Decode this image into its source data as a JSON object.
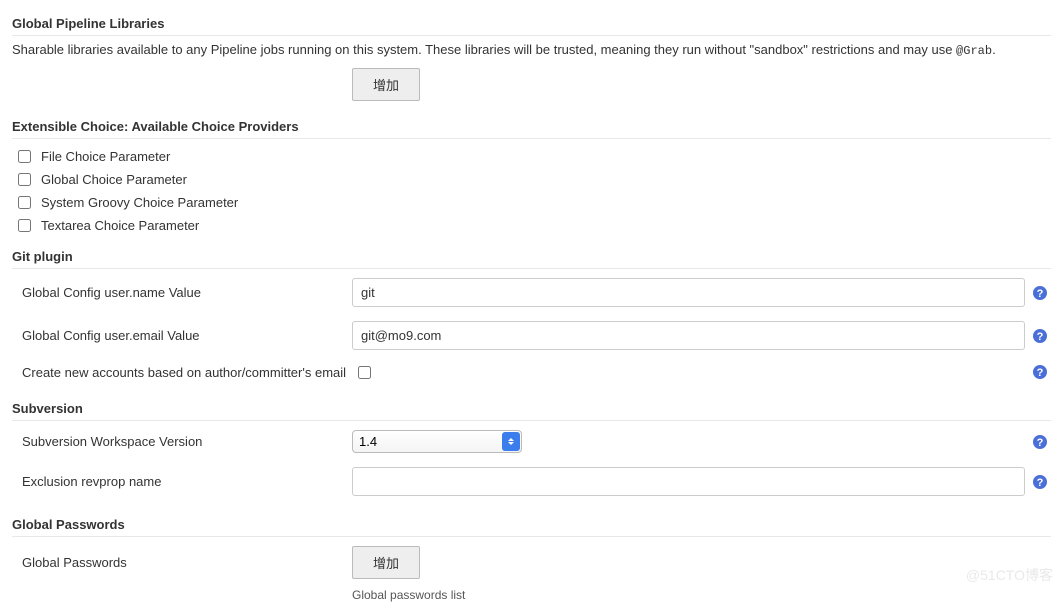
{
  "sections": {
    "pipeline": {
      "title": "Global Pipeline Libraries",
      "description_pre": "Sharable libraries available to any Pipeline jobs running on this system. These libraries will be trusted, meaning they run without \"sandbox\" restrictions and may use ",
      "description_code": "@Grab",
      "description_post": ".",
      "add_button": "增加"
    },
    "choices": {
      "title": "Extensible Choice: Available Choice Providers",
      "items": [
        {
          "label": "File Choice Parameter",
          "checked": false
        },
        {
          "label": "Global Choice Parameter",
          "checked": false
        },
        {
          "label": "System Groovy Choice Parameter",
          "checked": false
        },
        {
          "label": "Textarea Choice Parameter",
          "checked": false
        }
      ]
    },
    "git": {
      "title": "Git plugin",
      "user_name_label": "Global Config user.name Value",
      "user_name_value": "git",
      "user_email_label": "Global Config user.email Value",
      "user_email_value": "git@mo9.com",
      "create_accounts_label": "Create new accounts based on author/committer's email",
      "create_accounts_checked": false
    },
    "svn": {
      "title": "Subversion",
      "workspace_label": "Subversion Workspace Version",
      "workspace_value": "1.4",
      "exclusion_label": "Exclusion revprop name",
      "exclusion_value": ""
    },
    "passwords": {
      "title": "Global Passwords",
      "label": "Global Passwords",
      "add_button": "增加",
      "list_label": "Global passwords list"
    }
  },
  "watermark": "@51CTO博客"
}
